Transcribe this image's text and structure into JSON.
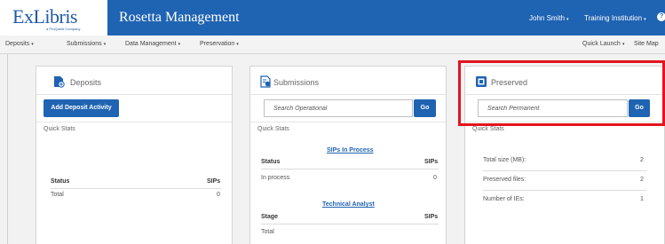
{
  "header": {
    "logo_text": "ExLibris",
    "logo_subtext": "a ProQuest Company",
    "app_title": "Rosetta Management",
    "user": "John Smith",
    "institution": "Training Institution",
    "help_label": "?",
    "caret": "▾",
    "accent_color": "#1f63b3"
  },
  "nav": {
    "items": [
      {
        "label": "Deposits"
      },
      {
        "label": "Submissions"
      },
      {
        "label": "Data Management"
      },
      {
        "label": "Preservation"
      }
    ],
    "quick_launch": "Quick Launch",
    "site_map": "Site Map",
    "caret": "▾"
  },
  "deposits": {
    "title": "Deposits",
    "icon": "deposit-icon",
    "button": "Add Deposit Activity",
    "quick_stats": "Quick Stats",
    "col_status": "Status",
    "col_sips": "SIPs",
    "rows": [
      {
        "status": "Total",
        "sips": "0"
      }
    ]
  },
  "submissions": {
    "title": "Submissions",
    "icon": "submission-icon",
    "search_placeholder": "Search Operational",
    "go": "Go",
    "quick_stats": "Quick Stats",
    "sips_in_process": "SIPs In Process",
    "col_status": "Status",
    "col_sips": "SIPs",
    "rows": [
      {
        "status": "In process",
        "sips": "0"
      }
    ],
    "technical_analyst": "Technical Analyst",
    "col_stage": "Stage",
    "col_sips2": "SIPs",
    "stage_rows": [
      {
        "stage": "Total"
      }
    ]
  },
  "preserved": {
    "title": "Preserved",
    "icon": "preserved-icon",
    "search_placeholder": "Search Permanent",
    "go": "Go",
    "quick_stats": "Quick Stats",
    "stats": [
      {
        "label": "Total size (MB):",
        "value": "2"
      },
      {
        "label": "Preserved files:",
        "value": "2"
      },
      {
        "label": "Number of IEs:",
        "value": "1"
      }
    ]
  },
  "highlight_color": "#e3141e"
}
